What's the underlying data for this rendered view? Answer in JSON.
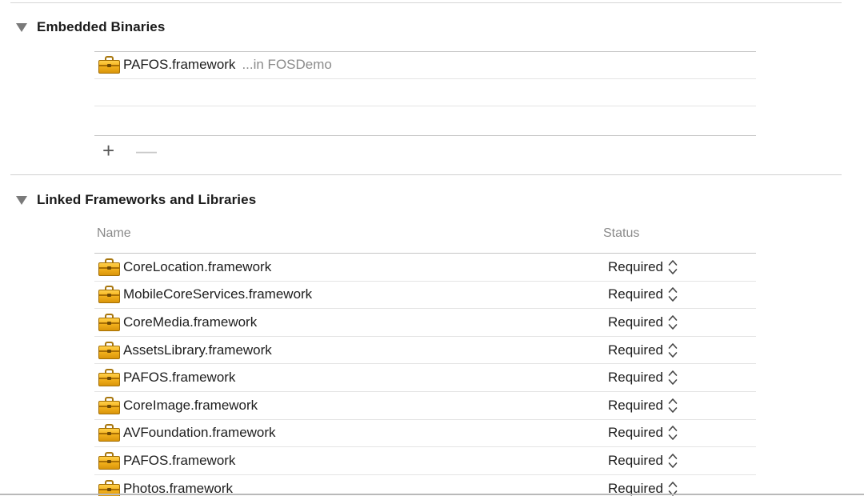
{
  "embedded_binaries": {
    "title": "Embedded Binaries",
    "rows": [
      {
        "name": "PAFOS.framework",
        "suffix": "...in FOSDemo"
      },
      {
        "name": "",
        "suffix": ""
      },
      {
        "name": "",
        "suffix": ""
      }
    ],
    "add_label": "+",
    "remove_label": "—"
  },
  "linked_frameworks": {
    "title": "Linked Frameworks and Libraries",
    "columns": {
      "name": "Name",
      "status": "Status"
    },
    "rows": [
      {
        "name": "CoreLocation.framework",
        "status": "Required"
      },
      {
        "name": "MobileCoreServices.framework",
        "status": "Required"
      },
      {
        "name": "CoreMedia.framework",
        "status": "Required"
      },
      {
        "name": "AssetsLibrary.framework",
        "status": "Required"
      },
      {
        "name": "PAFOS.framework",
        "status": "Required"
      },
      {
        "name": "CoreImage.framework",
        "status": "Required"
      },
      {
        "name": "AVFoundation.framework",
        "status": "Required"
      },
      {
        "name": "PAFOS.framework",
        "status": "Required"
      },
      {
        "name": "Photos.framework",
        "status": "Required"
      }
    ]
  },
  "icons": {
    "framework": "toolbox-icon",
    "disclosure": "disclosure-triangle-icon",
    "stepper": "up-down-chevron-icon"
  },
  "colors": {
    "framework_icon": "#f4b21d",
    "secondary_text": "#8b8b8b"
  }
}
